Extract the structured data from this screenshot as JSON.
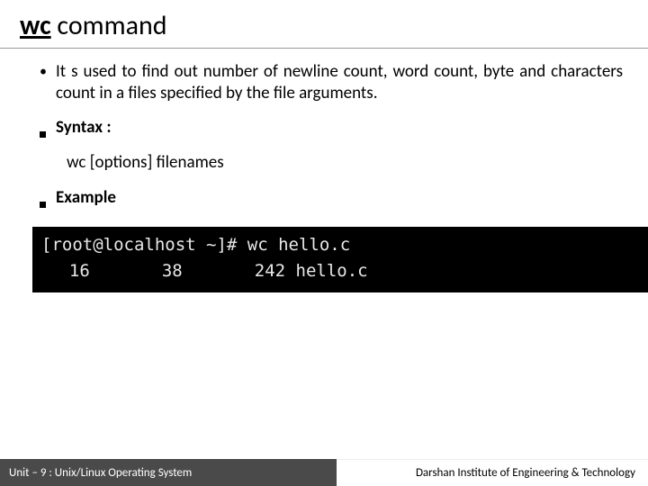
{
  "title": {
    "bold": "wc",
    "normal": " command"
  },
  "bullets": {
    "description": "It s used to find out number of newline count, word count, byte and characters count in a files specified by the file arguments.",
    "syntax_label": "Syntax :",
    "syntax_text": "wc [options] filenames",
    "example_label": "Example"
  },
  "terminal": {
    "line1": "[root@localhost ~]# wc hello.c",
    "line2": "  16       38       242 hello.c"
  },
  "footer": {
    "left": "Unit – 9  : Unix/Linux Operating System",
    "right": "Darshan Institute of Engineering & Technology"
  }
}
